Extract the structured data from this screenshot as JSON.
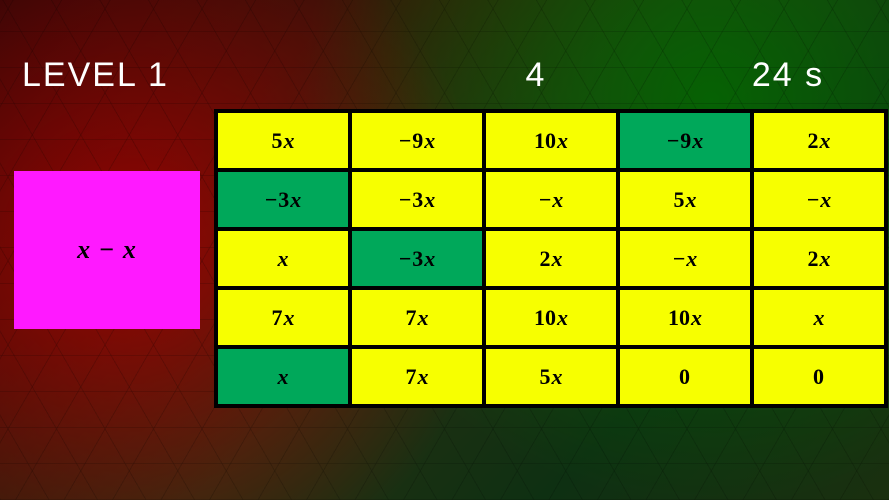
{
  "header": {
    "level_label": "LEVEL 1",
    "score": "4",
    "timer": "24 s"
  },
  "target": {
    "expression": "x − x"
  },
  "grid": {
    "cols": 5,
    "rows": 5,
    "cells": [
      {
        "text": "5x",
        "color": "yellow"
      },
      {
        "text": "−9x",
        "color": "yellow"
      },
      {
        "text": "10x",
        "color": "yellow"
      },
      {
        "text": "−9x",
        "color": "green"
      },
      {
        "text": "2x",
        "color": "yellow"
      },
      {
        "text": "−3x",
        "color": "green"
      },
      {
        "text": "−3x",
        "color": "yellow"
      },
      {
        "text": "−x",
        "color": "yellow"
      },
      {
        "text": "5x",
        "color": "yellow"
      },
      {
        "text": "−x",
        "color": "yellow"
      },
      {
        "text": "x",
        "color": "yellow"
      },
      {
        "text": "−3x",
        "color": "green"
      },
      {
        "text": "2x",
        "color": "yellow"
      },
      {
        "text": "−x",
        "color": "yellow"
      },
      {
        "text": "2x",
        "color": "yellow"
      },
      {
        "text": "7x",
        "color": "yellow"
      },
      {
        "text": "7x",
        "color": "yellow"
      },
      {
        "text": "10x",
        "color": "yellow"
      },
      {
        "text": "10x",
        "color": "yellow"
      },
      {
        "text": "x",
        "color": "yellow"
      },
      {
        "text": "x",
        "color": "green"
      },
      {
        "text": "7x",
        "color": "yellow"
      },
      {
        "text": "5x",
        "color": "yellow"
      },
      {
        "text": "0",
        "color": "yellow"
      },
      {
        "text": "0",
        "color": "yellow"
      }
    ]
  }
}
